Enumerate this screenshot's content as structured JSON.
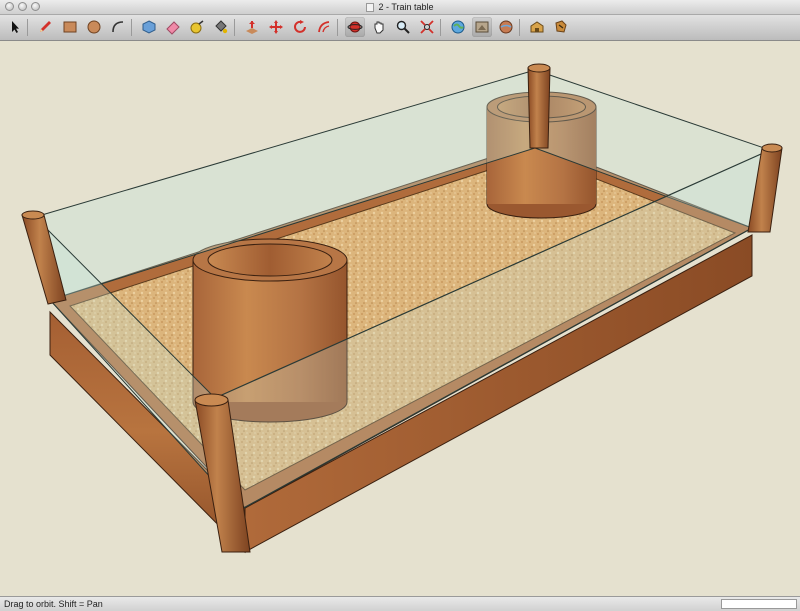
{
  "window": {
    "title": "2 - Train table"
  },
  "toolbar": {
    "tools": [
      {
        "name": "select-tool",
        "icon": "arrow-cursor-icon"
      },
      {
        "name": "pencil-tool",
        "icon": "pencil-icon"
      },
      {
        "name": "rectangle-tool",
        "icon": "rectangle-icon"
      },
      {
        "name": "circle-tool",
        "icon": "circle-icon"
      },
      {
        "name": "arc-tool",
        "icon": "arc-icon"
      },
      {
        "name": "make-component-tool",
        "icon": "component-icon"
      },
      {
        "name": "eraser-tool",
        "icon": "eraser-icon"
      },
      {
        "name": "tape-measure-tool",
        "icon": "tape-measure-icon"
      },
      {
        "name": "paint-bucket-tool",
        "icon": "paint-bucket-icon"
      },
      {
        "name": "push-pull-tool",
        "icon": "push-pull-icon"
      },
      {
        "name": "move-tool",
        "icon": "move-icon"
      },
      {
        "name": "rotate-tool",
        "icon": "rotate-icon"
      },
      {
        "name": "offset-tool",
        "icon": "offset-icon"
      },
      {
        "name": "orbit-tool",
        "icon": "orbit-icon"
      },
      {
        "name": "pan-tool",
        "icon": "hand-icon"
      },
      {
        "name": "zoom-tool",
        "icon": "magnifier-icon"
      },
      {
        "name": "zoom-extents-tool",
        "icon": "zoom-extents-icon"
      },
      {
        "name": "get-models-tool",
        "icon": "globe-icon"
      },
      {
        "name": "share-model-tool",
        "icon": "share-model-icon"
      },
      {
        "name": "google-earth-tool",
        "icon": "earth-icon"
      },
      {
        "name": "component-warehouse-tool",
        "icon": "warehouse-icon"
      },
      {
        "name": "extension-warehouse-tool",
        "icon": "extension-icon"
      }
    ],
    "active_tool": "orbit-tool"
  },
  "status": {
    "hint": "Drag to orbit.  Shift = Pan",
    "measurements_value": ""
  },
  "colors": {
    "viewport_background": "#e5e1cf",
    "wood": "#a8663a",
    "cork": "#d9b37a",
    "glass": "#c4e4da"
  }
}
